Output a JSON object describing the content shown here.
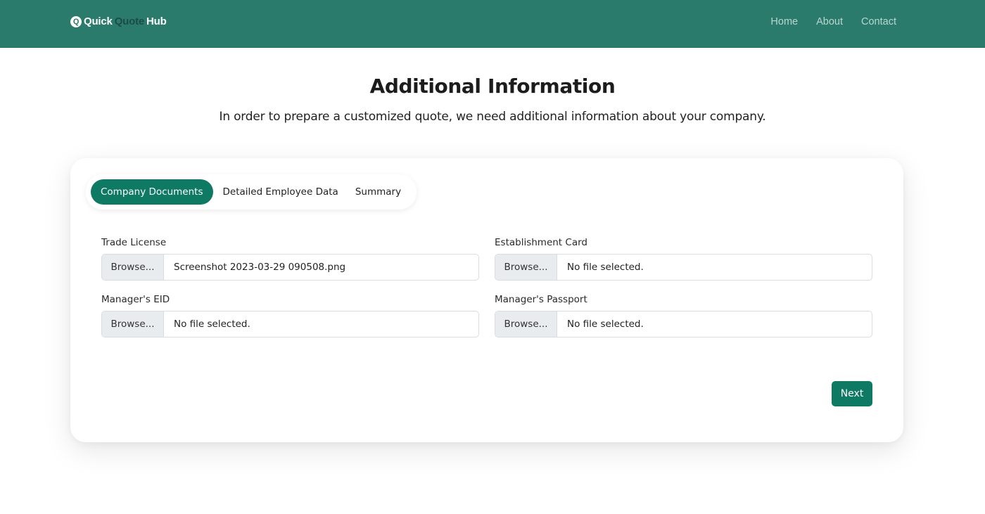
{
  "nav": {
    "logo": {
      "part1": "Quick",
      "part2": "Quote",
      "part3": "Hub",
      "icon": "Q"
    },
    "links": [
      "Home",
      "About",
      "Contact"
    ]
  },
  "header": {
    "title": "Additional Information",
    "subtitle": "In order to prepare a customized quote, we need additional information about your company."
  },
  "tabs": [
    {
      "label": "Company Documents",
      "active": true
    },
    {
      "label": "Detailed Employee Data",
      "active": false
    },
    {
      "label": "Summary",
      "active": false
    }
  ],
  "fields": {
    "trade_license": {
      "label": "Trade License",
      "button": "Browse...",
      "value": "Screenshot 2023-03-29 090508.png"
    },
    "establishment_card": {
      "label": "Establishment Card",
      "button": "Browse...",
      "value": "No file selected."
    },
    "manager_eid": {
      "label": "Manager's EID",
      "button": "Browse...",
      "value": "No file selected."
    },
    "manager_passport": {
      "label": "Manager's Passport",
      "button": "Browse...",
      "value": "No file selected."
    }
  },
  "actions": {
    "next": "Next"
  },
  "colors": {
    "navbar": "#2a7b6c",
    "accent": "#0e7a64"
  }
}
